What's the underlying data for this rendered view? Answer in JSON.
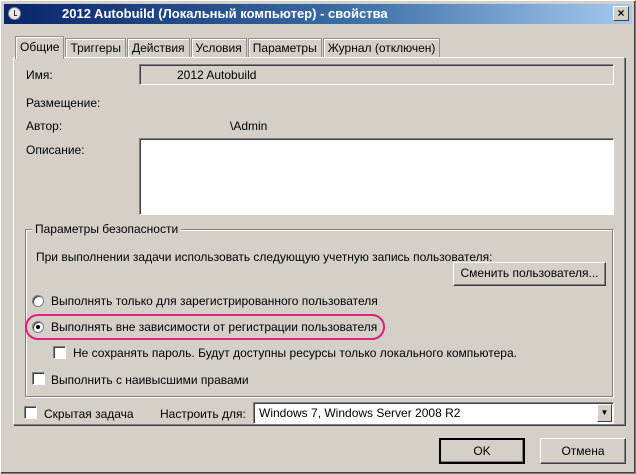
{
  "title": "2012 Autobuild (Локальный компьютер) - свойства",
  "tabs": [
    "Общие",
    "Триггеры",
    "Действия",
    "Условия",
    "Параметры",
    "Журнал (отключен)"
  ],
  "general": {
    "name_label": "Имя:",
    "name_value": "2012 Autobuild",
    "location_label": "Размещение:",
    "author_label": "Автор:",
    "author_value": "\\Admin",
    "description_label": "Описание:"
  },
  "security": {
    "legend": "Параметры безопасности",
    "account_text": "При выполнении задачи использовать следующую учетную запись пользователя:",
    "change_user_button": "Сменить пользователя...",
    "radio_logged_on": "Выполнять только для зарегистрированного пользователя",
    "radio_whether": "Выполнять вне зависимости от регистрации пользователя",
    "no_store_password": "Не сохранять пароль. Будут доступны ресурсы только локального компьютера.",
    "highest_privileges": "Выполнить с наивысшими правами"
  },
  "hidden_label": "Скрытая задача",
  "configure_label": "Настроить для:",
  "configure_value": "Windows 7, Windows Server 2008 R2",
  "ok": "OK",
  "cancel": "Отмена"
}
